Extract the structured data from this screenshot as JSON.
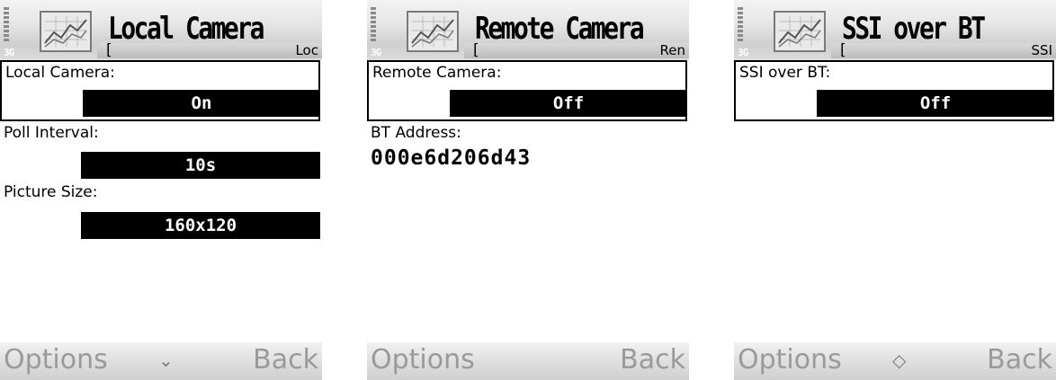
{
  "screens": [
    {
      "title": "Local Camera",
      "nav_text": "Loc",
      "status": "3G",
      "fields": [
        {
          "label": "Local Camera:",
          "value": "On"
        },
        {
          "label": "Poll Interval:",
          "value": "10s"
        },
        {
          "label": "Picture Size:",
          "value": "160x120"
        }
      ],
      "softkeys": {
        "left": "Options",
        "right": "Back",
        "middle": "⌄"
      }
    },
    {
      "title": "Remote Camera",
      "nav_text": "Ren",
      "status": "3G",
      "fields": [
        {
          "label": "Remote Camera:",
          "value": "Off"
        },
        {
          "label": "BT Address:",
          "value": "000e6d206d43"
        }
      ],
      "softkeys": {
        "left": "Options",
        "right": "Back"
      }
    },
    {
      "title": "SSI over BT",
      "nav_text": "SSI",
      "status": "3G",
      "fields": [
        {
          "label": "SSI over BT:",
          "value": "Off"
        }
      ],
      "softkeys": {
        "left": "Options",
        "right": "Back",
        "middle": "◇"
      }
    }
  ]
}
